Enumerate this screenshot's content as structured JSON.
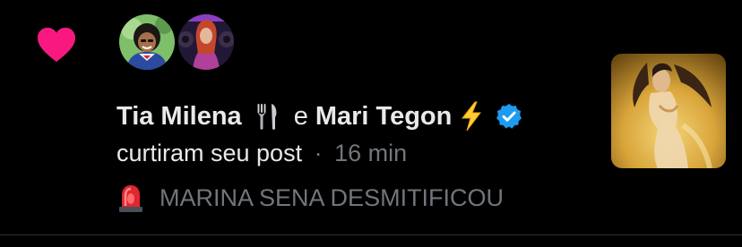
{
  "notification": {
    "type_icon": "heart-icon",
    "accent_color": "#f91880",
    "verified_color": "#1d9bf0",
    "users": [
      {
        "name": "Tia Milena",
        "emoji": "fork-and-knife-icon"
      },
      {
        "name": "Mari Tegon",
        "emoji": "lightning-bolt-icon",
        "verified": true
      }
    ],
    "conjunction": "e",
    "action": "curtiram seu post",
    "separator": "·",
    "time": "16 min",
    "post_snippet": "MARINA SENA DESMITIFICOU",
    "post_snippet_icon": "rotating-light-icon"
  }
}
